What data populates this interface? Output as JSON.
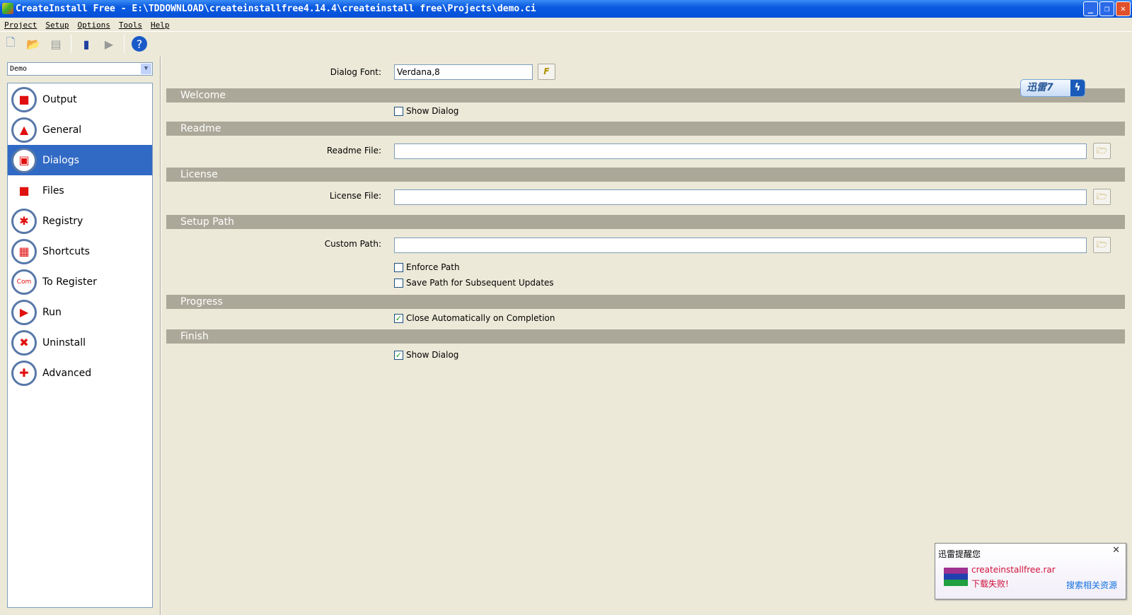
{
  "window": {
    "title": "CreateInstall Free - E:\\TDDOWNLOAD\\createinstallfree4.14.4\\createinstall free\\Projects\\demo.ci"
  },
  "menu": [
    "Project",
    "Setup",
    "Options",
    "Tools",
    "Help"
  ],
  "toolbar": [
    "new-file-icon",
    "open-folder-icon",
    "properties-icon",
    "build-icon",
    "run-icon",
    "help-icon"
  ],
  "project_select": {
    "value": "Demo"
  },
  "nav": {
    "selected": "Dialogs",
    "items": [
      {
        "label": "Output",
        "icon": "output-icon"
      },
      {
        "label": "General",
        "icon": "general-icon"
      },
      {
        "label": "Dialogs",
        "icon": "dialogs-icon"
      },
      {
        "label": "Files",
        "icon": "files-icon"
      },
      {
        "label": "Registry",
        "icon": "registry-icon"
      },
      {
        "label": "Shortcuts",
        "icon": "shortcuts-icon"
      },
      {
        "label": "To Register",
        "icon": "register-icon"
      },
      {
        "label": "Run",
        "icon": "run-icon"
      },
      {
        "label": "Uninstall",
        "icon": "uninstall-icon"
      },
      {
        "label": "Advanced",
        "icon": "advanced-icon"
      }
    ]
  },
  "dialogs": {
    "font_label": "Dialog Font:",
    "font_value": "Verdana,8",
    "font_button": "F",
    "welcome": {
      "title": "Welcome",
      "show_dialog": "Show Dialog",
      "checked": false
    },
    "readme": {
      "title": "Readme",
      "label": "Readme File:",
      "value": ""
    },
    "license": {
      "title": "License",
      "label": "License File:",
      "value": ""
    },
    "setup_path": {
      "title": "Setup Path",
      "label": "Custom Path:",
      "value": "",
      "enforce": "Enforce Path",
      "enforce_checked": false,
      "save": "Save Path for Subsequent Updates",
      "save_checked": false
    },
    "progress": {
      "title": "Progress",
      "close_auto": "Close Automatically on Completion",
      "checked": true
    },
    "finish": {
      "title": "Finish",
      "show_dialog": "Show Dialog",
      "checked": true
    }
  },
  "xunlei_badge": "迅雷7",
  "popup": {
    "title": "迅雷提醒您",
    "filename": "createinstallfree.rar",
    "status": "下载失败!",
    "link": "搜索相关资源",
    "close": "✕"
  }
}
